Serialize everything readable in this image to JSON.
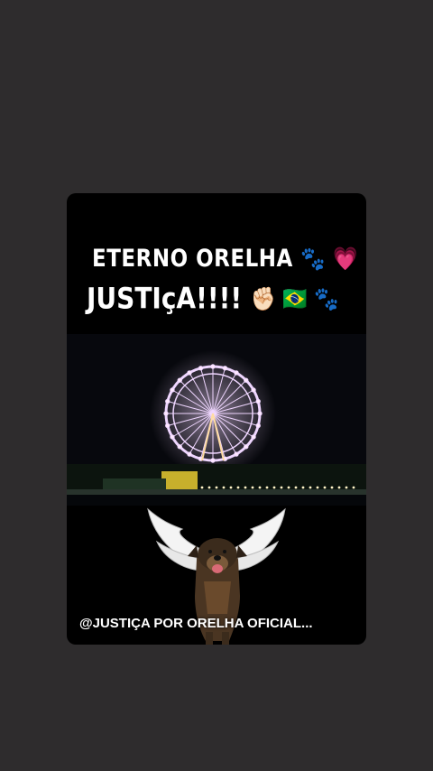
{
  "story": {
    "line1": "ETERNO ORELHA",
    "line1_emojis": "🐾 💗 🕊",
    "line2": "JUSTIçA!!!!",
    "line2_emojis": "✊🏻 🇧🇷 🐾",
    "handle": "@JUSTIÇA  POR ORELHA OFICIAL..."
  },
  "colors": {
    "background": "#2e2c2d",
    "card": "#000000",
    "ferris_wheel": "#e6c3ff"
  }
}
